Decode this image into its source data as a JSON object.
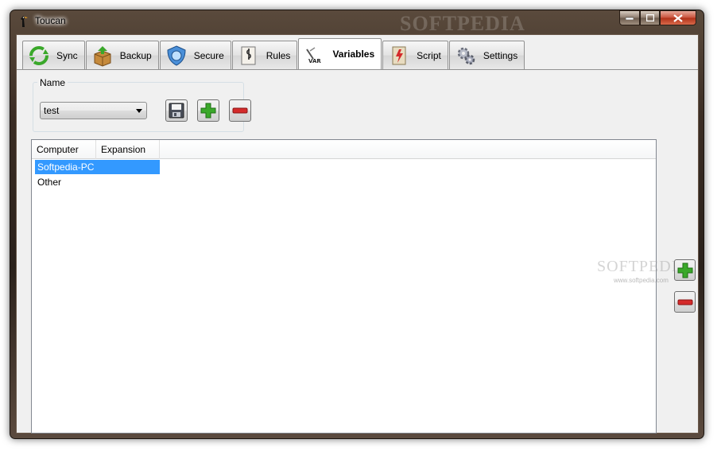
{
  "window": {
    "title": "Toucan",
    "watermark": "SOFTPEDIA"
  },
  "tabs": [
    {
      "label": "Sync",
      "icon": "sync-icon"
    },
    {
      "label": "Backup",
      "icon": "backup-icon"
    },
    {
      "label": "Secure",
      "icon": "secure-icon"
    },
    {
      "label": "Rules",
      "icon": "rules-icon"
    },
    {
      "label": "Variables",
      "icon": "variables-icon",
      "active": true
    },
    {
      "label": "Script",
      "icon": "script-icon"
    },
    {
      "label": "Settings",
      "icon": "settings-icon"
    }
  ],
  "name_group": {
    "legend": "Name",
    "selected_value": "test"
  },
  "variables_list": {
    "columns": [
      "Computer",
      "Expansion"
    ],
    "rows": [
      {
        "computer": "Softpedia-PC",
        "expansion": "",
        "selected": true
      },
      {
        "computer": "Other",
        "expansion": "",
        "selected": false
      }
    ]
  },
  "side_watermark": {
    "text": "SOFTPEDIA",
    "url": "www.softpedia.com"
  },
  "colors": {
    "selection": "#3399ff",
    "add_green": "#3aa82a",
    "remove_red": "#d42a2a"
  }
}
